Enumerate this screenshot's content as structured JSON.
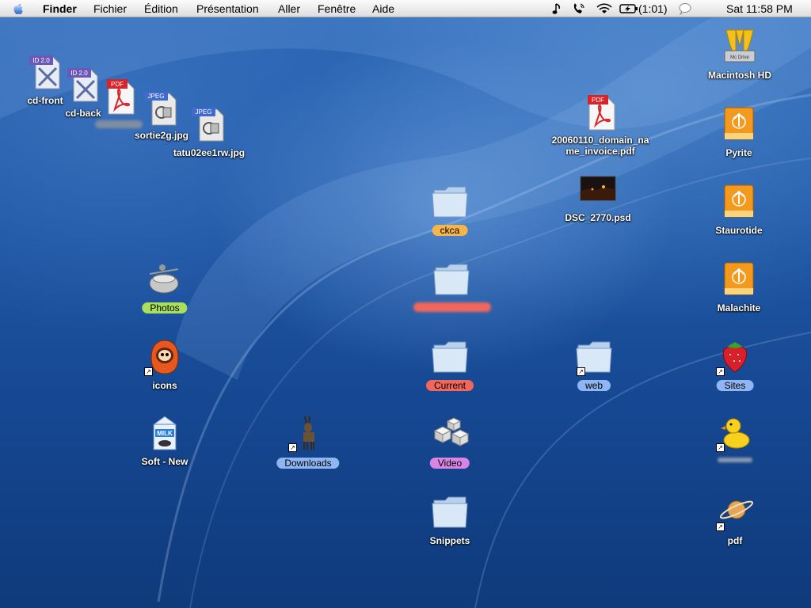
{
  "menubar": {
    "app_name": "Finder",
    "menus": [
      "Fichier",
      "Édition",
      "Présentation",
      "Aller",
      "Fenêtre",
      "Aide"
    ],
    "battery": "(1:01)",
    "clock": "Sat 11:58 PM",
    "status_icons": [
      "music-note-icon",
      "phone-icon",
      "wifi-icon",
      "battery-icon",
      "speech-bubble-icon"
    ]
  },
  "desktop": {
    "files": {
      "cd_front": "cd-front",
      "cd_back": "cd-back",
      "sortie": "sortie2g.jpg",
      "tatu": "tatu02ee1rw.jpg",
      "invoice_line1": "20060110_domain_na",
      "invoice_line2": "me_invoice.pdf",
      "dsc": "DSC_2770.psd"
    },
    "badges": {
      "id": "ID 2.0",
      "pdf": "PDF",
      "jpeg": "JPEG",
      "adobe": "Adobe",
      "milk": "MILK",
      "drive": "Mc Drive"
    },
    "folders": {
      "ckca": "ckca",
      "current": "Current",
      "video": "Video",
      "snippets": "Snippets",
      "web": "web",
      "photos": "Photos",
      "icons": "icons",
      "soft": "Soft - New",
      "downloads": "Downloads",
      "sites": "Sites",
      "pdf": "pdf"
    },
    "volumes": {
      "hd": "Macintosh HD",
      "pyrite": "Pyrite",
      "staurotide": "Staurotide",
      "malachite": "Malachite"
    },
    "label_colors": {
      "orange": "#f5b54a",
      "red": "#f2675c",
      "green": "#a9df5a",
      "purple": "#d985e3",
      "blue": "#8fb6f2"
    }
  }
}
